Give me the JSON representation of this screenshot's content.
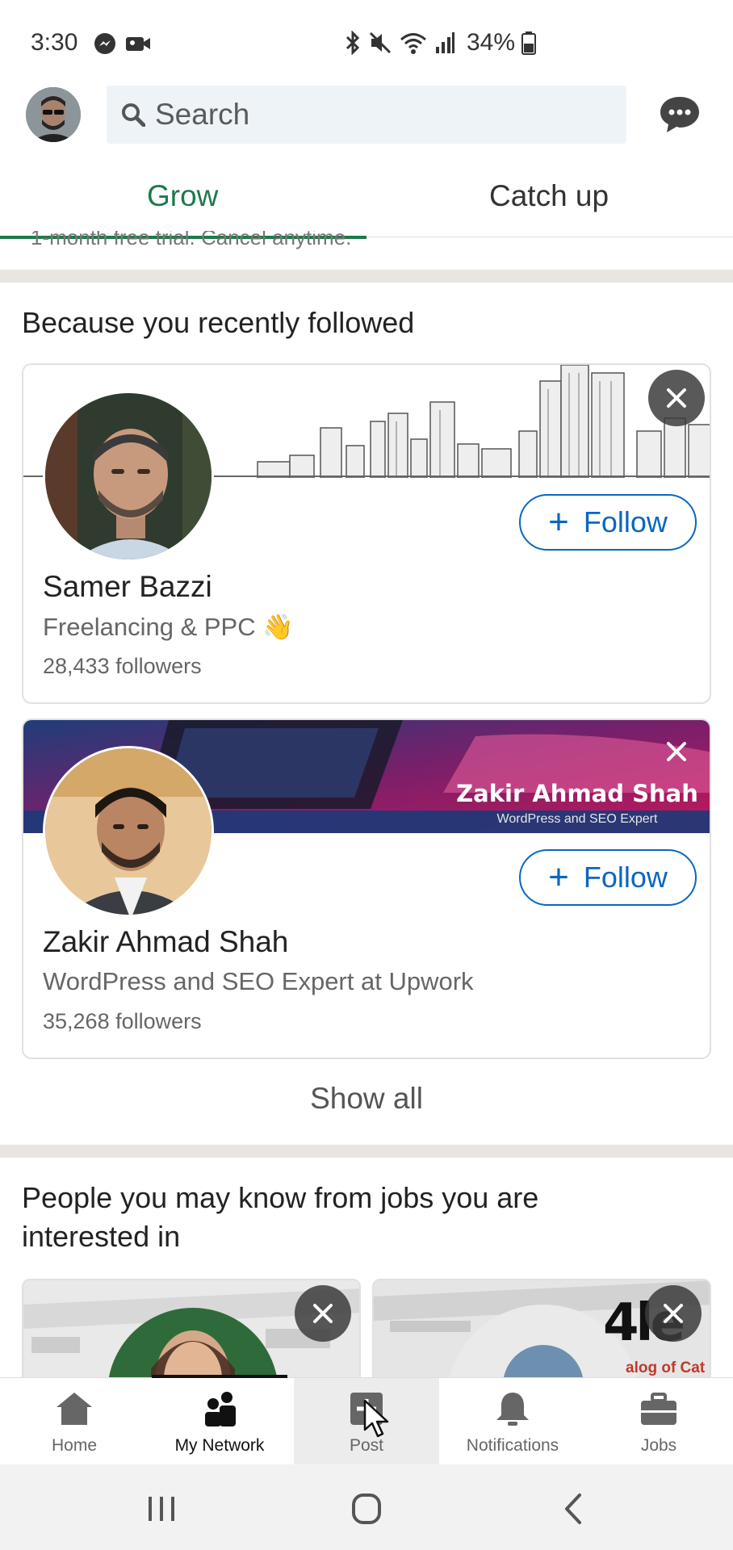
{
  "status_bar": {
    "time": "3:30",
    "battery": "34%",
    "icons": [
      "messenger-icon",
      "video-icon",
      "bluetooth-icon",
      "mute-icon",
      "wifi-icon",
      "signal-icon",
      "battery-icon"
    ]
  },
  "top_bar": {
    "search_placeholder": "Search",
    "icons": [
      "avatar",
      "search-icon",
      "messaging-icon"
    ]
  },
  "tabs": [
    {
      "label": "Grow",
      "active": true
    },
    {
      "label": "Catch up",
      "active": false
    }
  ],
  "clipped_text": "1-month free trial. Cancel anytime.",
  "recently_followed": {
    "title": "Because you recently followed",
    "cards": [
      {
        "name": "Samer Bazzi",
        "headline": "Freelancing & PPC 👋",
        "followers": "28,433 followers",
        "follow_label": "Follow"
      },
      {
        "name": "Zakir Ahmad Shah",
        "headline": "WordPress and SEO Expert  at Upwork",
        "followers": "35,268 followers",
        "follow_label": "Follow",
        "banner_title": "Zakir Ahmad Shah",
        "banner_subtitle": "WordPress and SEO Expert"
      }
    ],
    "show_all": "Show all"
  },
  "people_section": {
    "title_line1": "People you may know from jobs you are",
    "title_line2": "interested in",
    "logo_text": "4le",
    "logo_caption": "alog of Cat"
  },
  "bottom_nav": [
    {
      "label": "Home",
      "icon": "home-icon",
      "active": false
    },
    {
      "label": "My Network",
      "icon": "network-icon",
      "active": true
    },
    {
      "label": "Post",
      "icon": "post-icon",
      "active": false
    },
    {
      "label": "Notifications",
      "icon": "bell-icon",
      "active": false
    },
    {
      "label": "Jobs",
      "icon": "briefcase-icon",
      "active": false
    }
  ],
  "colors": {
    "accent_green": "#1d7a4a",
    "link_blue": "#0a66c2",
    "divider": "#e9e6e1"
  }
}
